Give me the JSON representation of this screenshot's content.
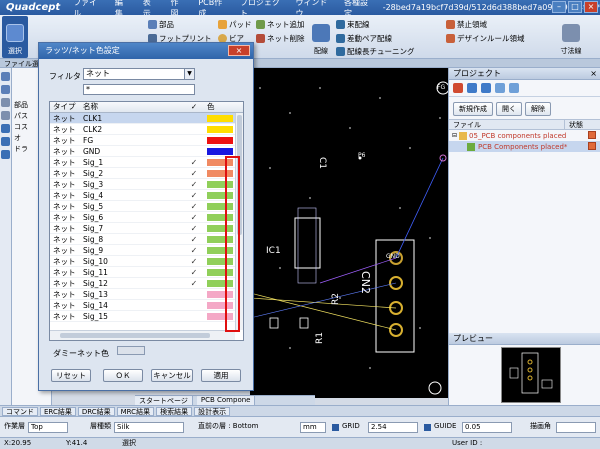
{
  "titlebar": {
    "logo": "Quadcept",
    "menus": [
      "ファイル",
      "編集",
      "表示",
      "作図",
      "PCB作成",
      "プロジェクト",
      "ウィンドウ",
      "各種設定"
    ],
    "document": "-28bed7a19bcf7d39d/512d6d388bed7a09489d84f9}*"
  },
  "ribbon": {
    "select_label": "選択",
    "part": "部品",
    "footprint": "フットプリント",
    "pad": "パッド",
    "via": "ビア",
    "net_add": "ネット追加",
    "net_delete": "ネット削除",
    "routing": "配線",
    "free_routing": "束配線",
    "diff_pair": "差動ペア配線",
    "length_tune": "配線長チューニング",
    "keepout": "禁止領域",
    "design_rule": "デザインルール領域",
    "dimension": "寸法線"
  },
  "doc_strip": "ファイル選",
  "left_panel": [
    "部品",
    "パス",
    "コス",
    "オ",
    "ドラ"
  ],
  "dialog": {
    "title": "ラッツ/ネット色設定",
    "filter_label": "フィルタ",
    "filter_value": "ネット",
    "filter_text": "*",
    "columns": {
      "type": "タイプ",
      "name": "名称",
      "color": "色"
    },
    "rows": [
      {
        "type": "ネット",
        "name": "CLK1",
        "checked": false,
        "color": "#ffdd00"
      },
      {
        "type": "ネット",
        "name": "CLK2",
        "checked": false,
        "color": "#ffdd00"
      },
      {
        "type": "ネット",
        "name": "FG",
        "checked": false,
        "color": "#ee1111"
      },
      {
        "type": "ネット",
        "name": "GND",
        "checked": false,
        "color": "#1818e0"
      },
      {
        "type": "ネット",
        "name": "Sig_1",
        "checked": true,
        "color": "#f08a62"
      },
      {
        "type": "ネット",
        "name": "Sig_2",
        "checked": true,
        "color": "#f08a62"
      },
      {
        "type": "ネット",
        "name": "Sig_3",
        "checked": true,
        "color": "#90cf5a"
      },
      {
        "type": "ネット",
        "name": "Sig_4",
        "checked": true,
        "color": "#90cf5a"
      },
      {
        "type": "ネット",
        "name": "Sig_5",
        "checked": true,
        "color": "#90cf5a"
      },
      {
        "type": "ネット",
        "name": "Sig_6",
        "checked": true,
        "color": "#90cf5a"
      },
      {
        "type": "ネット",
        "name": "Sig_7",
        "checked": true,
        "color": "#90cf5a"
      },
      {
        "type": "ネット",
        "name": "Sig_8",
        "checked": true,
        "color": "#90cf5a"
      },
      {
        "type": "ネット",
        "name": "Sig_9",
        "checked": true,
        "color": "#90cf5a"
      },
      {
        "type": "ネット",
        "name": "Sig_10",
        "checked": true,
        "color": "#90cf5a"
      },
      {
        "type": "ネット",
        "name": "Sig_11",
        "checked": true,
        "color": "#90cf5a"
      },
      {
        "type": "ネット",
        "name": "Sig_12",
        "checked": true,
        "color": "#90cf5a"
      },
      {
        "type": "ネット",
        "name": "Sig_13",
        "checked": false,
        "color": "#f4a8c6"
      },
      {
        "type": "ネット",
        "name": "Sig_14",
        "checked": false,
        "color": "#f4a8c6"
      },
      {
        "type": "ネット",
        "name": "Sig_15",
        "checked": false,
        "color": "#f4a8c6"
      }
    ],
    "dummy_label": "ダミーネット色",
    "buttons": {
      "reset": "リセット",
      "ok": "ＯＫ",
      "cancel": "キャンセル",
      "apply": "適用"
    }
  },
  "project": {
    "title": "プロジェクト",
    "buttons": [
      "新規作成",
      "開く",
      "解除"
    ],
    "columns": {
      "file": "ファイル",
      "status": "状態"
    },
    "items": [
      {
        "label": "05_PCB components placed",
        "color": "#c0392b"
      },
      {
        "label": "PCB Components placed*",
        "color": "#c0392b"
      }
    ]
  },
  "preview": {
    "title": "プレビュー"
  },
  "doc_tabs": [
    "スタートページ",
    "PCB Compone"
  ],
  "bottom_tabs": [
    "コマンド",
    "ERC結果",
    "DRC結果",
    "MRC結果",
    "検索結果",
    "設計表示"
  ],
  "propbar": {
    "layer_label": "作業層",
    "layer_value": "Top",
    "layer_type_label": "層種類",
    "layer_type_value": "Silk",
    "prev_layer_label": "直前の層 : Bottom",
    "unit": "mm",
    "grid_label": "GRID",
    "grid_value": "2.54",
    "guide_label": "GUIDE",
    "guide_value": "0.05",
    "angle_label": "描画角"
  },
  "statusbar": {
    "x": "X:20.95",
    "y": "Y:41.4",
    "mode": "選択",
    "user": "User ID :"
  },
  "canvas": {
    "labels": [
      "C1",
      "IC1",
      "R2",
      "R1",
      "CN2",
      "GND",
      "FG",
      "P6"
    ]
  }
}
